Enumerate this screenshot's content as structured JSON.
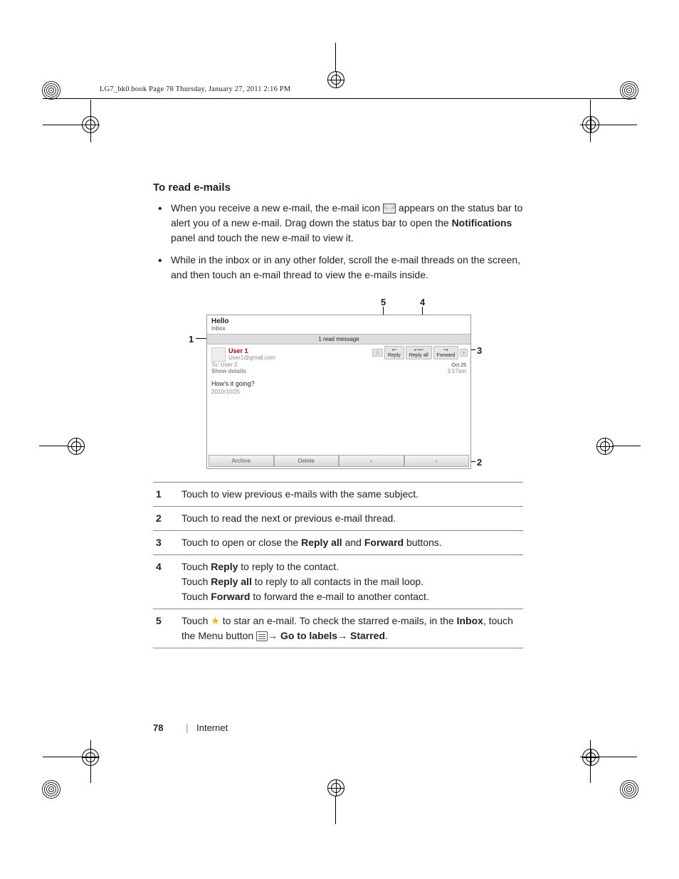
{
  "doc_header": "LG7_bk0.book  Page 78  Thursday, January 27, 2011  2:16 PM",
  "section_title": "To read e-mails",
  "bullet1_a": "When you receive a new e-mail, the e-mail icon ",
  "bullet1_b": " appears on the status bar to alert you of a new e-mail. Drag down the status bar to open the ",
  "bullet1_notif": "Notifications",
  "bullet1_c": " panel and touch the new e-mail to view it.",
  "bullet2": "While in the inbox or in any other folder, scroll the e-mail threads on the screen, and then touch an e-mail thread to view the e-mails inside.",
  "callouts": {
    "c1": "1",
    "c2": "2",
    "c3": "3",
    "c4": "4",
    "c5": "5"
  },
  "screen": {
    "title": "Hello",
    "subject": "Inbox",
    "read_msg": "1 read message",
    "user1": "User 1",
    "user1_email": "User1@gmail.com",
    "to_line": "To: User 2",
    "show_details": "Show details",
    "body_line": "How's it going?",
    "body_date": "2010/10/25",
    "reply": "Reply",
    "reply_all": "Reply all",
    "forward": "Forward",
    "star_btn": "☆",
    "date": "Oct 25",
    "time": "3:57am",
    "archive": "Archive",
    "delete": "Delete",
    "nav_prev": "‹",
    "nav_next": "›"
  },
  "legend": {
    "r1": "Touch to view previous e-mails with the same subject.",
    "r2": "Touch to read the next or previous e-mail thread.",
    "r3_a": "Touch to open or close the ",
    "r3_replyall": "Reply all",
    "r3_and": " and ",
    "r3_forward": "Forward",
    "r3_b": " buttons.",
    "r4_a": "Touch ",
    "r4_reply": "Reply",
    "r4_b": " to reply to the contact.",
    "r4_c": "Touch ",
    "r4_replyall": "Reply all",
    "r4_d": " to reply to all contacts in the mail loop.",
    "r4_e": "Touch ",
    "r4_forward": "Forward",
    "r4_f": " to forward the e-mail to another contact.",
    "r5_a": "Touch ",
    "r5_b": " to star an e-mail. To check the starred e-mails, in the ",
    "r5_inbox": "Inbox",
    "r5_c": ", touch the Menu button ",
    "r5_arrow1": "→ ",
    "r5_goto": "Go to labels",
    "r5_arrow2": "→ ",
    "r5_starred": "Starred",
    "r5_period": "."
  },
  "footer": {
    "page": "78",
    "section": "Internet"
  }
}
